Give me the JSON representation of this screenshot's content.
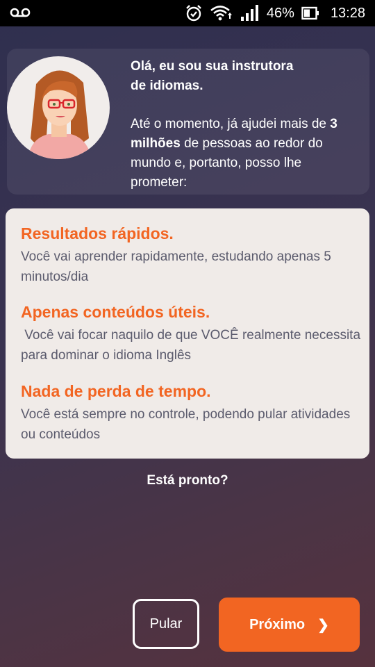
{
  "status_bar": {
    "battery_percent": "46%",
    "time": "13:28",
    "icons": [
      "voicemail-icon",
      "alarm-icon",
      "wifi-icon",
      "signal-icon",
      "battery-icon"
    ]
  },
  "intro": {
    "title_line1": "Olá, eu sou sua instrutora",
    "title_line2": "de idiomas.",
    "para_prefix": "Até o momento, já ajudei mais de ",
    "para_bold": "3 milhões",
    "para_suffix": " de pessoas ao redor do mundo e, portanto, posso lhe prometer:"
  },
  "benefits": [
    {
      "title": "Resultados rápidos.",
      "text": "Você vai aprender rapidamente, estudando apenas 5 minutos/dia"
    },
    {
      "title": "Apenas conteúdos úteis.",
      "text": " Você vai focar naquilo de que VOCÊ realmente necessita para dominar o idioma Inglês"
    },
    {
      "title": "Nada de perda de tempo.",
      "text": "Você está sempre no controle, podendo pular atividades ou conteúdos"
    }
  ],
  "ready_text": "Está pronto?",
  "buttons": {
    "skip_label": "Pular",
    "next_label": "Próximo",
    "next_icon": "chevron-right-icon"
  },
  "colors": {
    "accent": "#f26522",
    "card_bg": "#f0ebe8"
  }
}
